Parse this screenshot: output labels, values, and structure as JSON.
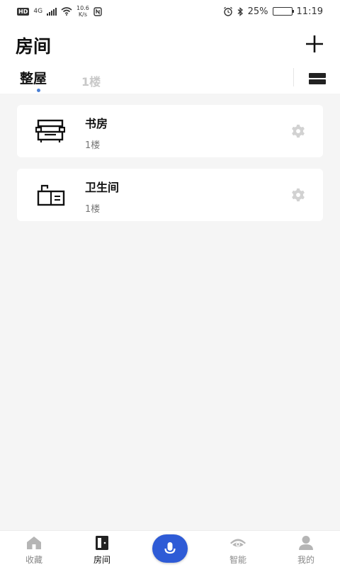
{
  "status_bar": {
    "hd": "HD",
    "network": "4G",
    "speed_value": "10.6",
    "speed_unit": "K/s",
    "battery": "25%",
    "battery_level": 0.25,
    "time": "11:19"
  },
  "header": {
    "title": "房间",
    "add_icon": "plus-icon"
  },
  "tabs": [
    {
      "label": "整屋",
      "active": true
    },
    {
      "label": "1楼",
      "active": false
    }
  ],
  "layout_toggle_icon": "list-view-icon",
  "rooms": [
    {
      "name": "书房",
      "floor": "1楼",
      "icon": "desk-icon"
    },
    {
      "name": "卫生间",
      "floor": "1楼",
      "icon": "cabinet-icon"
    }
  ],
  "bottom_nav": [
    {
      "label": "收藏",
      "icon": "home-icon",
      "active": false
    },
    {
      "label": "房间",
      "icon": "door-icon",
      "active": true
    },
    {
      "label": "智能",
      "icon": "eye-icon",
      "active": false
    },
    {
      "label": "我的",
      "icon": "user-icon",
      "active": false
    }
  ],
  "voice_button_icon": "microphone-icon",
  "colors": {
    "accent": "#2e5bd6",
    "indicator": "#4a7fd4",
    "background": "#f5f5f5"
  }
}
